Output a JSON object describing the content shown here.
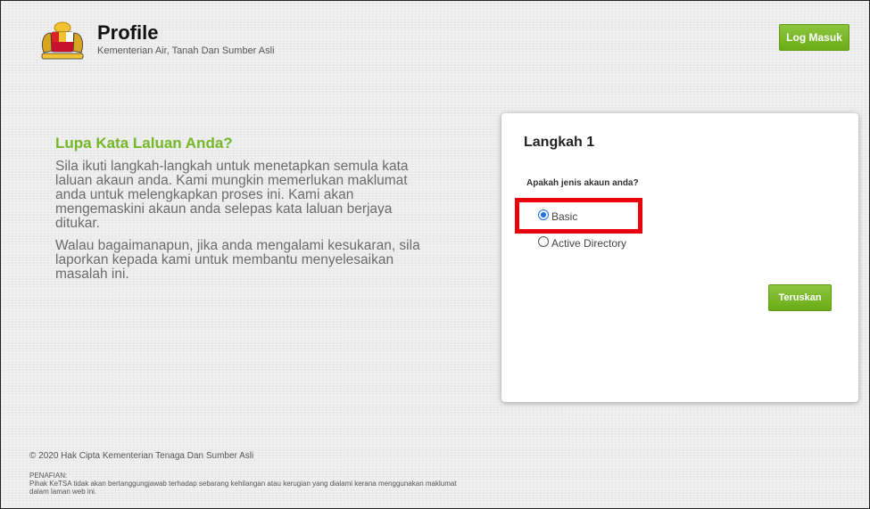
{
  "header": {
    "title": "Profile",
    "subtitle": "Kementerian Air, Tanah Dan Sumber Asli",
    "login_label": "Log Masuk",
    "logo_icon": "coat-of-arms-icon"
  },
  "info": {
    "heading": "Lupa Kata Laluan Anda?",
    "para1": "Sila ikuti langkah-langkah untuk menetapkan semula kata laluan akaun anda. Kami mungkin memerlukan maklumat anda untuk melengkapkan proses ini. Kami akan mengemaskini akaun anda selepas kata laluan berjaya ditukar.",
    "para2": "Walau bagaimanapun, jika anda mengalami kesukaran, sila laporkan kepada kami untuk membantu menyelesaikan masalah ini."
  },
  "card": {
    "step_title": "Langkah 1",
    "question": "Apakah jenis akaun anda?",
    "options": [
      "Basic",
      "Active Directory"
    ],
    "selected": "Basic",
    "continue_label": "Teruskan"
  },
  "footer": {
    "copyright": "© 2020 Hak Cipta Kementerian Tenaga Dan Sumber Asli",
    "disclaimer_title": "PENAFIAN:",
    "disclaimer_text": "Pihak KeTSA tidak akan bertanggungjawab terhadap sebarang kehilangan atau kerugian yang dialami kerana menggunakan maklumat dalam laman web ini."
  },
  "colors": {
    "accent_green": "#76b72a",
    "button_green": "#7ab929",
    "highlight_red": "#e8000b",
    "radio_blue": "#1a73e8"
  }
}
